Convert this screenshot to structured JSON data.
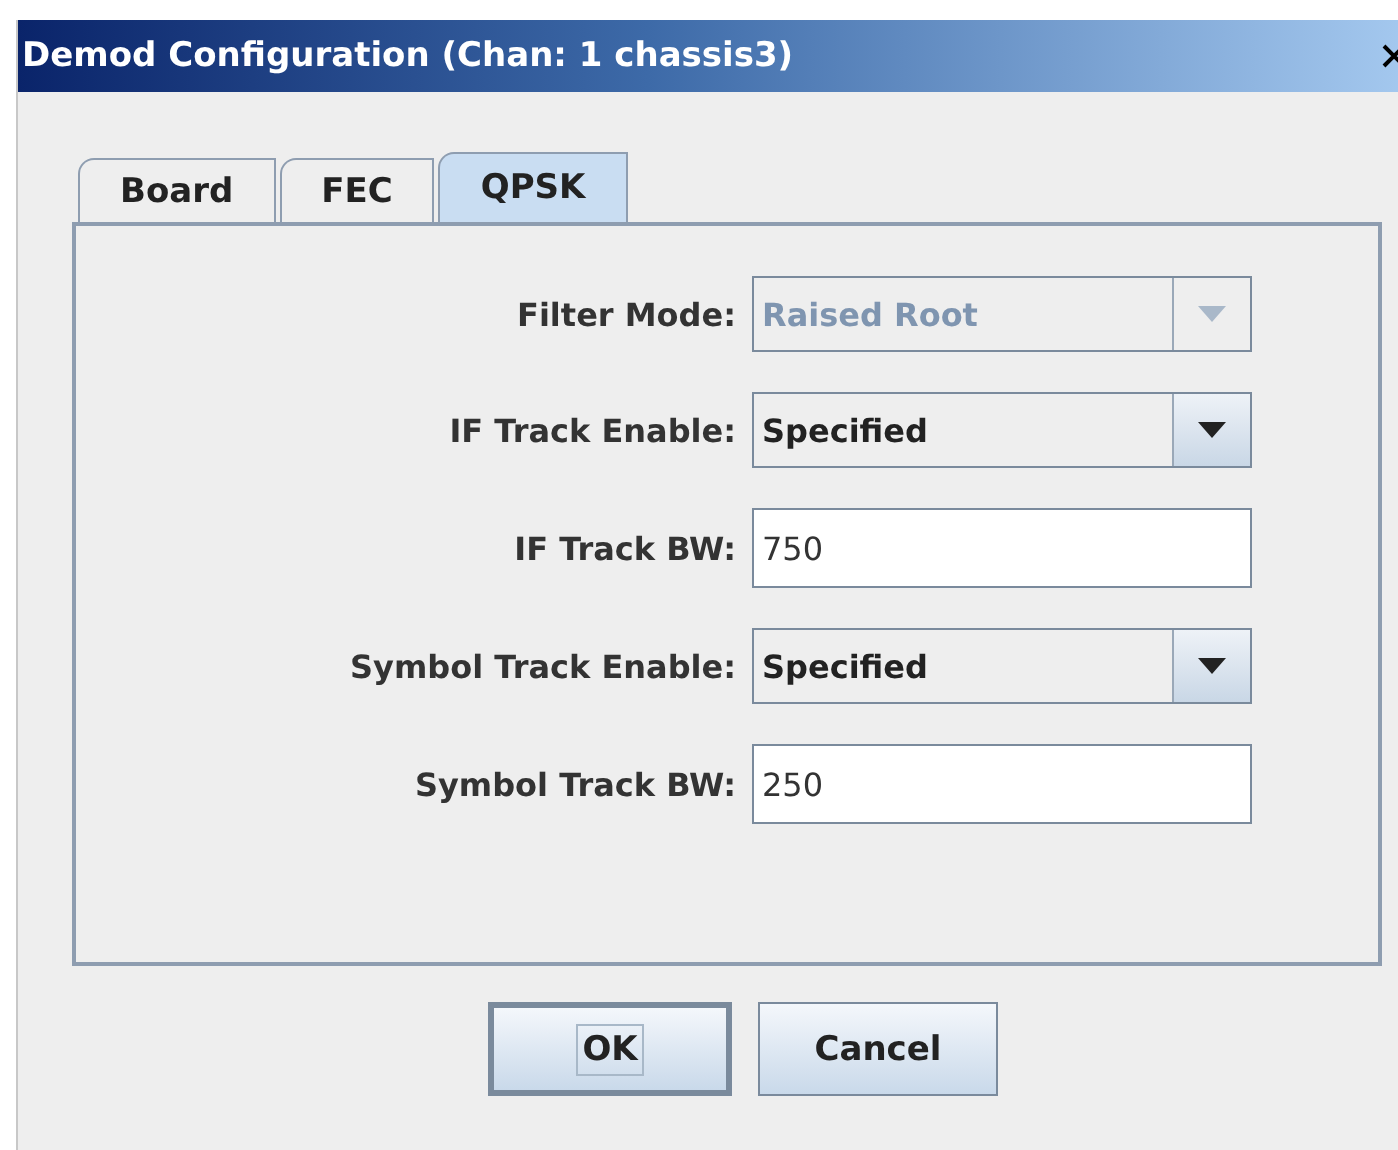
{
  "window": {
    "title": "Demod Configuration (Chan: 1 chassis3)"
  },
  "tabs": [
    {
      "label": "Board",
      "selected": false
    },
    {
      "label": "FEC",
      "selected": false
    },
    {
      "label": "QPSK",
      "selected": true
    }
  ],
  "fields": [
    {
      "label": "Filter Mode:",
      "kind": "combo",
      "value": "Raised Root",
      "disabled": true
    },
    {
      "label": "IF Track Enable:",
      "kind": "combo",
      "value": "Specified",
      "disabled": false
    },
    {
      "label": "IF Track BW:",
      "kind": "text",
      "value": "750",
      "disabled": false
    },
    {
      "label": "Symbol Track Enable:",
      "kind": "combo",
      "value": "Specified",
      "disabled": false
    },
    {
      "label": "Symbol Track BW:",
      "kind": "text",
      "value": "250",
      "disabled": false
    }
  ],
  "buttons": [
    {
      "label": "OK",
      "default": true
    },
    {
      "label": "Cancel",
      "default": false
    }
  ]
}
